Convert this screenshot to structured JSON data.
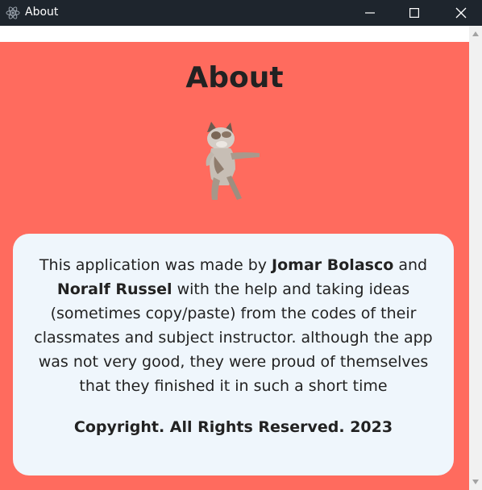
{
  "window": {
    "title": "About",
    "icon": "electron-app-icon",
    "controls": [
      "minimize-icon",
      "maximize-icon",
      "close-icon"
    ]
  },
  "page": {
    "heading": "About",
    "image": "dancing-cat-image",
    "description": {
      "part1": "This application was made by ",
      "author1": "Jomar Bolasco",
      "part2": " and ",
      "author2": "Noralf Russel",
      "part3": " with the help and taking ideas (sometimes copy/paste) from the codes of their classmates and subject instructor. although the app was not very good, they were proud of themselves that they finished it in such a short time"
    },
    "copyright": "Copyright. All Rights Reserved. 2023"
  },
  "colors": {
    "titlebar": "#1e252d",
    "background": "#ff6b5e",
    "card": "#eff6fc",
    "text": "#222222"
  }
}
